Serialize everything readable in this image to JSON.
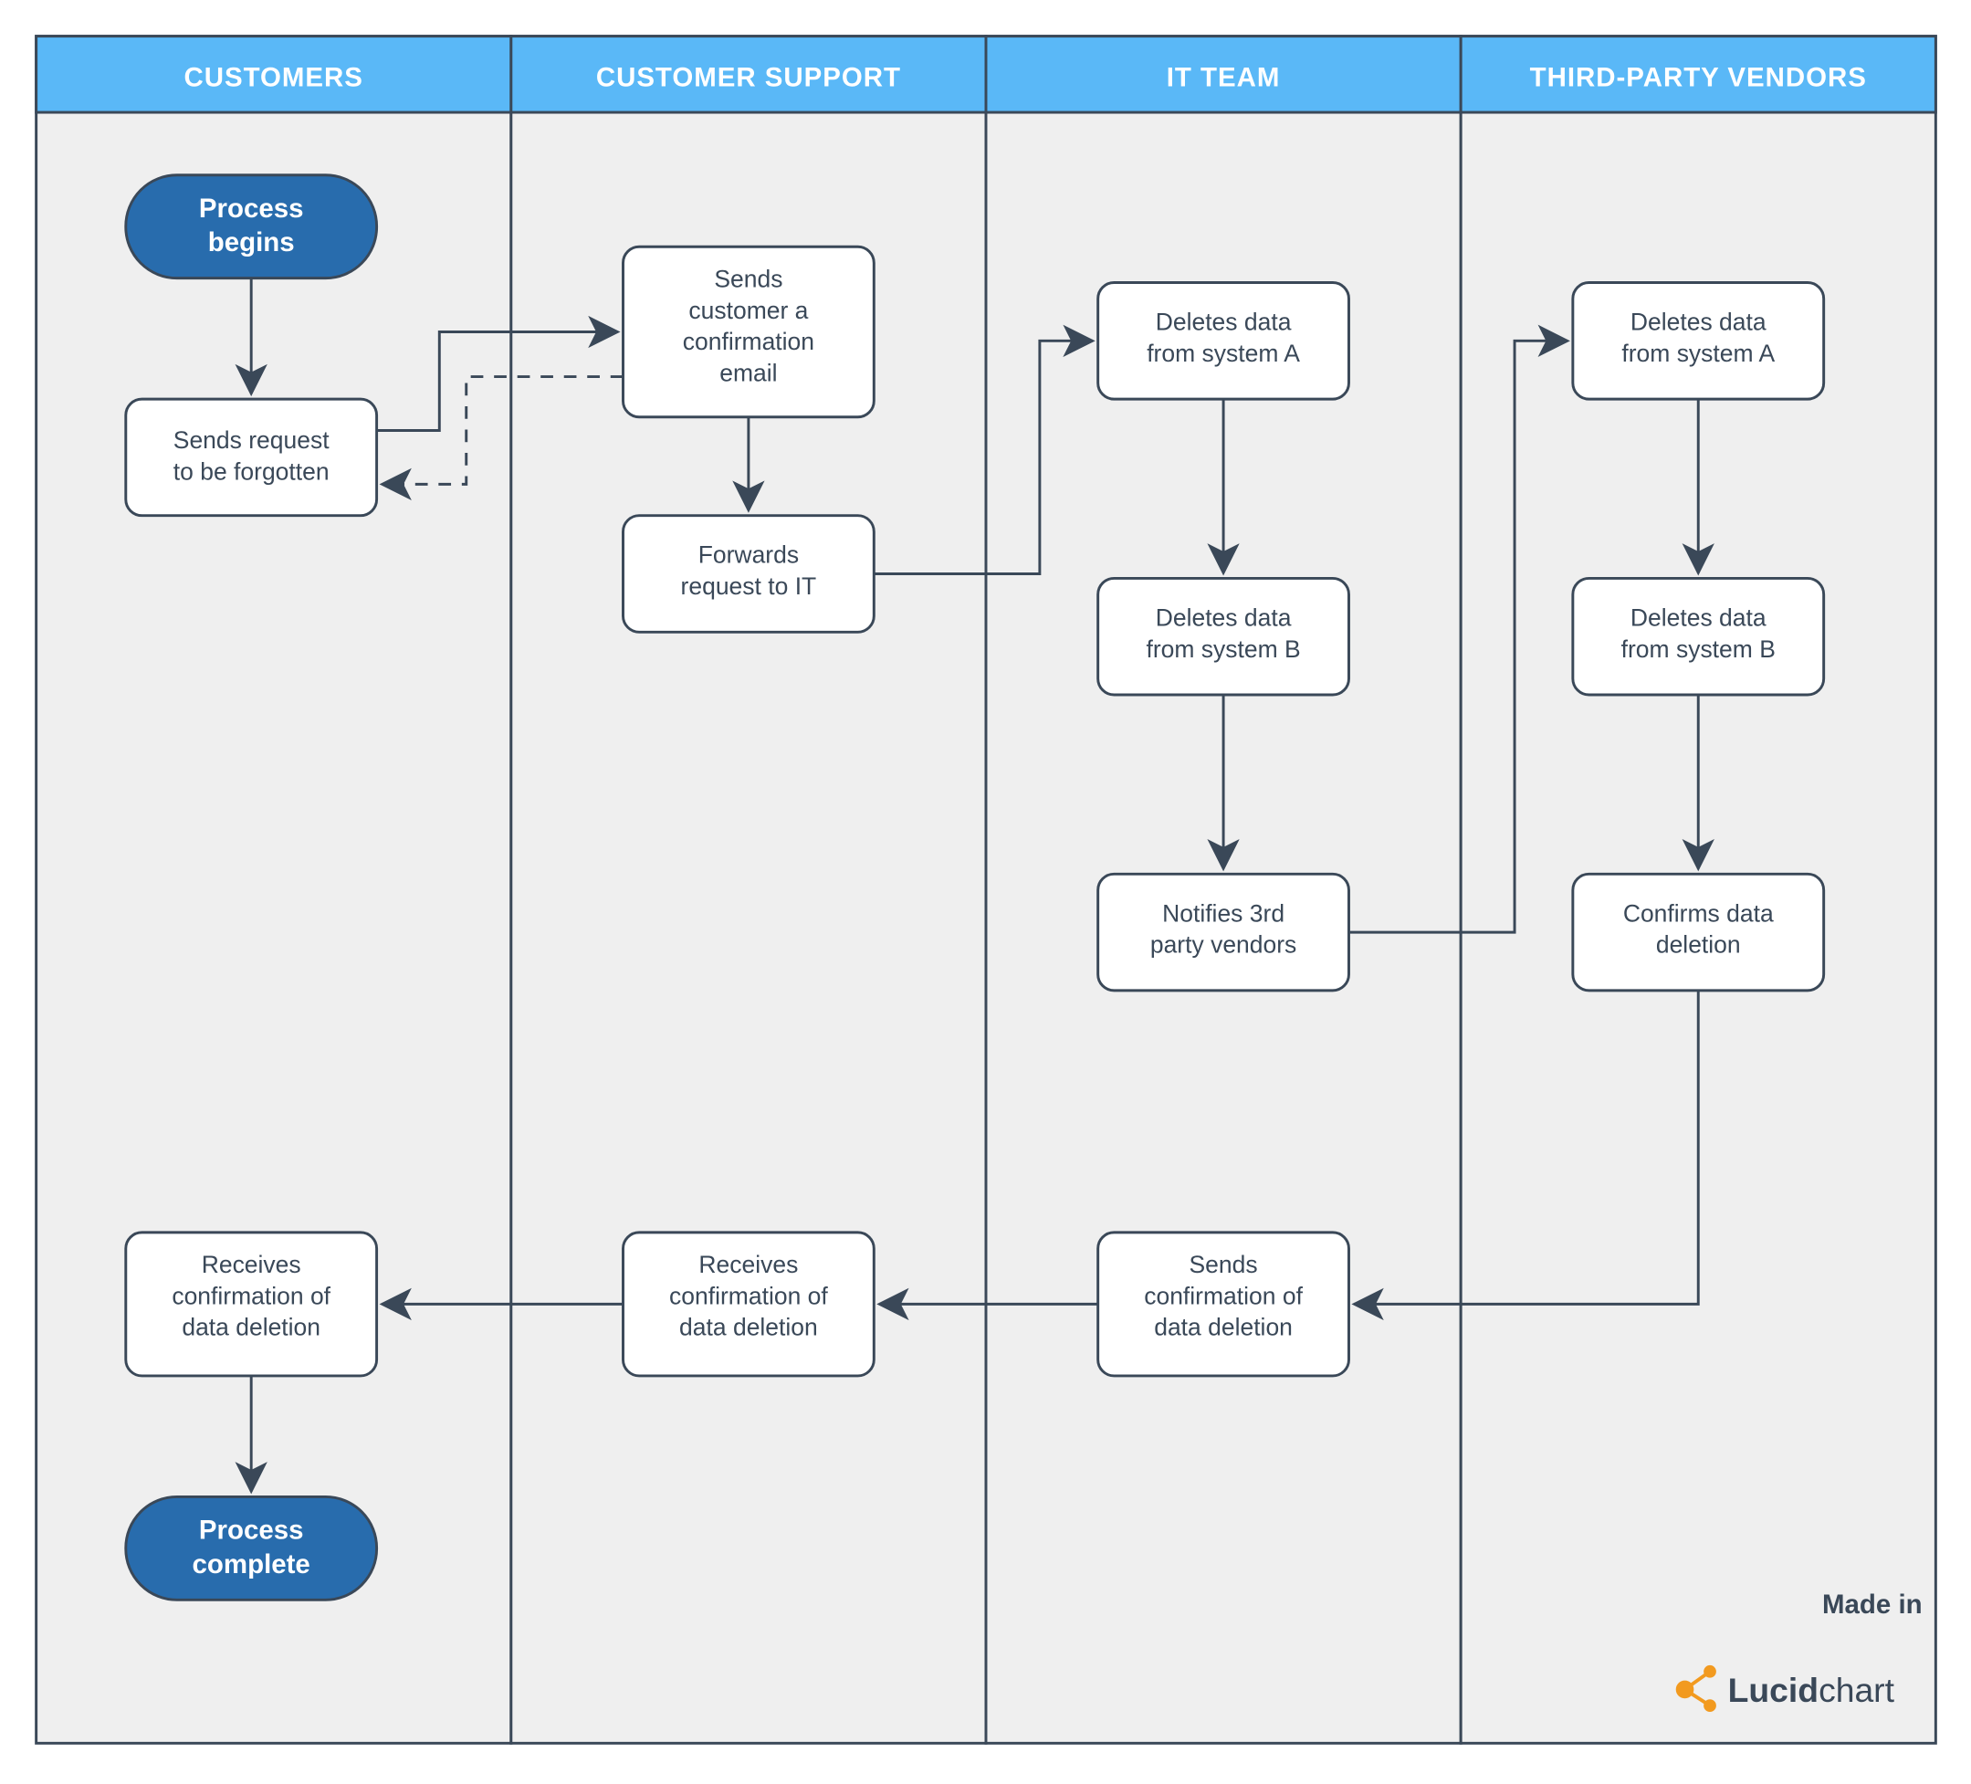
{
  "lanes": {
    "l1": "CUSTOMERS",
    "l2": "CUSTOMER SUPPORT",
    "l3": "IT TEAM",
    "l4": "THIRD-PARTY VENDORS"
  },
  "nodes": {
    "start1": "Process",
    "start2": "begins",
    "end1": "Process",
    "end2": "complete",
    "a1": "Sends request",
    "a2": "to be forgotten",
    "b1": "Sends",
    "b2": "customer a",
    "b3": "confirmation",
    "b4": "email",
    "c1": "Forwards",
    "c2": "request to IT",
    "d1": "Deletes data",
    "d2": "from system A",
    "e1": "Deletes data",
    "e2": "from system B",
    "f1": "Notifies 3rd",
    "f2": "party vendors",
    "g1": "Deletes data",
    "g2": "from system A",
    "h1": "Deletes data",
    "h2": "from system B",
    "i1": "Confirms data",
    "i2": "deletion",
    "j1": "Sends",
    "j2": "confirmation of",
    "j3": "data deletion",
    "k1": "Receives",
    "k2": "confirmation of",
    "k3": "data deletion",
    "l1": "Receives",
    "l2": "confirmation of",
    "l3": "data deletion"
  },
  "branding": {
    "made": "Made in",
    "logo1": "Lucid",
    "logo2": "chart"
  },
  "colors": {
    "header": "#5AB8F7",
    "terminator": "#286CAD",
    "stroke": "#3A4858",
    "lane_bg": "#EFEFEF",
    "accent": "#F29A1F"
  }
}
